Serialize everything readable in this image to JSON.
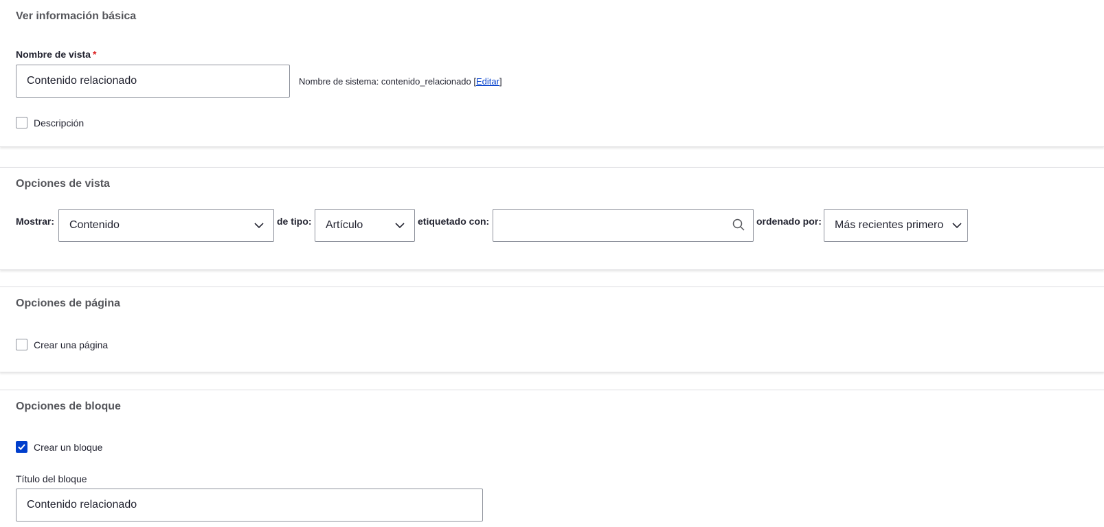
{
  "basic_info": {
    "title": "Ver información básica",
    "view_name_label": "Nombre de vista",
    "required_mark": "*",
    "view_name_value": "Contenido relacionado",
    "machine_name_prefix": "Nombre de sistema: contenido_relacionado [",
    "machine_name_edit": "Editar",
    "machine_name_suffix": "]",
    "description_label": "Descripción",
    "description_checked": false
  },
  "view_options": {
    "title": "Opciones de vista",
    "show_label": "Mostrar:",
    "show_value": "Contenido",
    "type_label": "de tipo:",
    "type_value": "Artículo",
    "tagged_label": "etiquetado con:",
    "tagged_value": "",
    "sort_label": "ordenado por:",
    "sort_value": "Más recientes primero"
  },
  "page_options": {
    "title": "Opciones de página",
    "create_page_label": "Crear una página",
    "create_page_checked": false
  },
  "block_options": {
    "title": "Opciones de bloque",
    "create_block_label": "Crear un bloque",
    "create_block_checked": true,
    "block_title_label": "Título del bloque",
    "block_title_value": "Contenido relacionado"
  },
  "colors": {
    "accent": "#003ecc",
    "required": "#dc2323",
    "heading": "#55565b",
    "border": "#8e929c"
  },
  "icons": {
    "dropdown": "chevron-down-icon",
    "search": "search-icon",
    "check": "checkmark-icon"
  }
}
